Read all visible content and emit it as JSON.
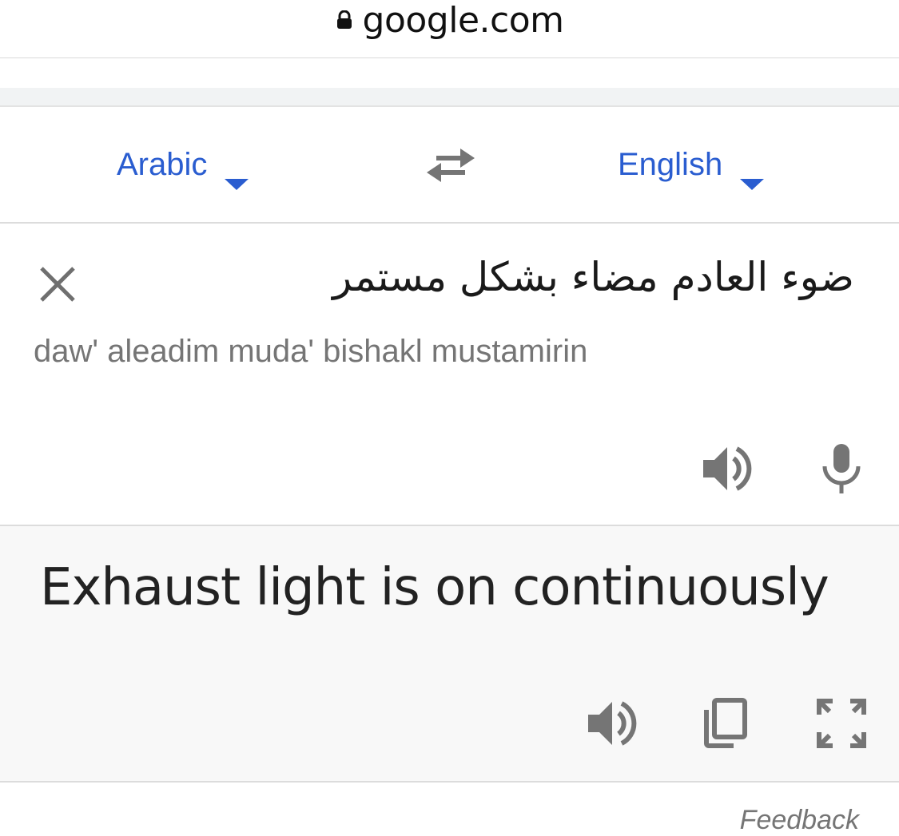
{
  "browser": {
    "url": "google.com",
    "lock_icon": "lock-icon"
  },
  "language_bar": {
    "source_language": "Arabic",
    "target_language": "English",
    "swap_icon": "swap-arrows-icon",
    "accent_color": "#2a5dd0"
  },
  "source_panel": {
    "text": "ضوء العادم مضاء بشكل مستمر",
    "transliteration": "daw' aleadim muda' bishakl mustamirin",
    "icons": [
      "close-icon",
      "speaker-icon",
      "microphone-icon"
    ]
  },
  "result_panel": {
    "text": "Exhaust light is on continuously",
    "icons": [
      "speaker-icon",
      "copy-icon",
      "fullscreen-icon"
    ]
  },
  "footer": {
    "feedback_label": "Feedback"
  }
}
